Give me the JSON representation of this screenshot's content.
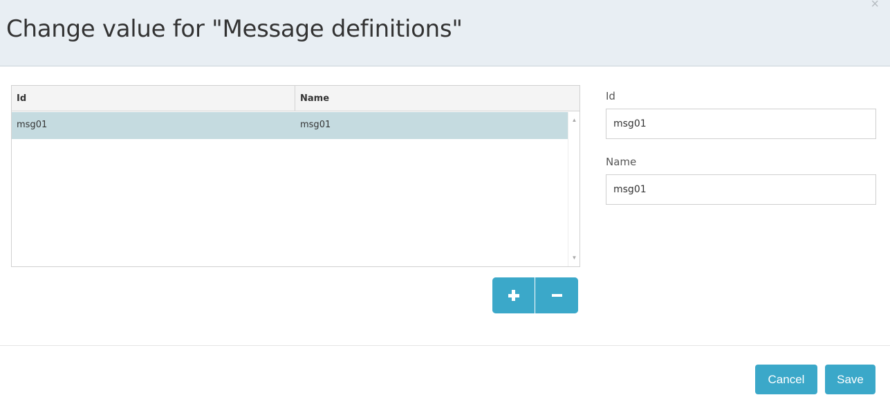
{
  "dialog": {
    "title": "Change value for \"Message definitions\"",
    "close_glyph": "×"
  },
  "grid": {
    "columns": [
      "Id",
      "Name"
    ],
    "rows": [
      {
        "id": "msg01",
        "name": "msg01",
        "selected": true
      }
    ],
    "scroll_up_glyph": "▲",
    "scroll_down_glyph": "▼"
  },
  "row_actions": {
    "add_icon": "plus-icon",
    "remove_icon": "minus-icon"
  },
  "form": {
    "id_label": "Id",
    "id_value": "msg01",
    "name_label": "Name",
    "name_value": "msg01"
  },
  "footer": {
    "cancel_label": "Cancel",
    "save_label": "Save"
  },
  "colors": {
    "accent": "#3ba8c9",
    "header_bg": "#e8eef3",
    "selected_row": "#c5dbe0"
  }
}
